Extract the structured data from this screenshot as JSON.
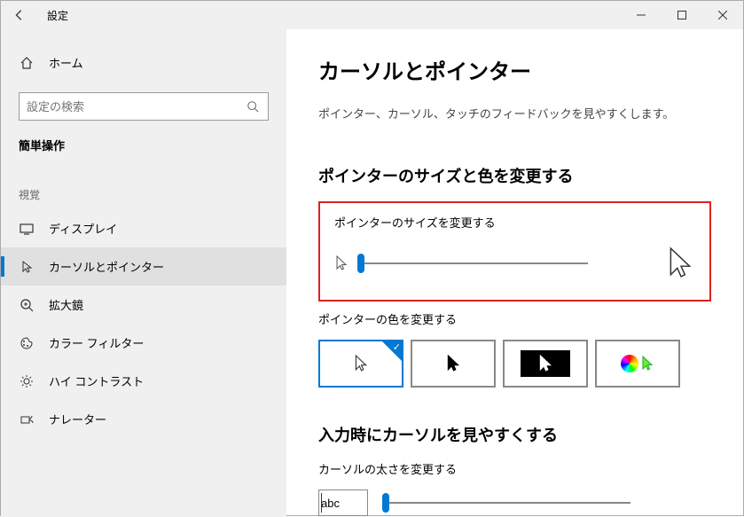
{
  "titlebar": {
    "title": "設定"
  },
  "sidebar": {
    "home_label": "ホーム",
    "search_placeholder": "設定の検索",
    "group_title": "簡単操作",
    "section_label": "視覚",
    "items": [
      {
        "label": "ディスプレイ"
      },
      {
        "label": "カーソルとポインター"
      },
      {
        "label": "拡大鏡"
      },
      {
        "label": "カラー フィルター"
      },
      {
        "label": "ハイ コントラスト"
      },
      {
        "label": "ナレーター"
      }
    ]
  },
  "content": {
    "heading": "カーソルとポインター",
    "description": "ポインター、カーソル、タッチのフィードバックを見やすくします。",
    "section1_heading": "ポインターのサイズと色を変更する",
    "size_label": "ポインターのサイズを変更する",
    "color_label": "ポインターの色を変更する",
    "section2_heading": "入力時にカーソルを見やすくする",
    "thickness_label": "カーソルの太さを変更する",
    "abc_sample": "abc"
  }
}
